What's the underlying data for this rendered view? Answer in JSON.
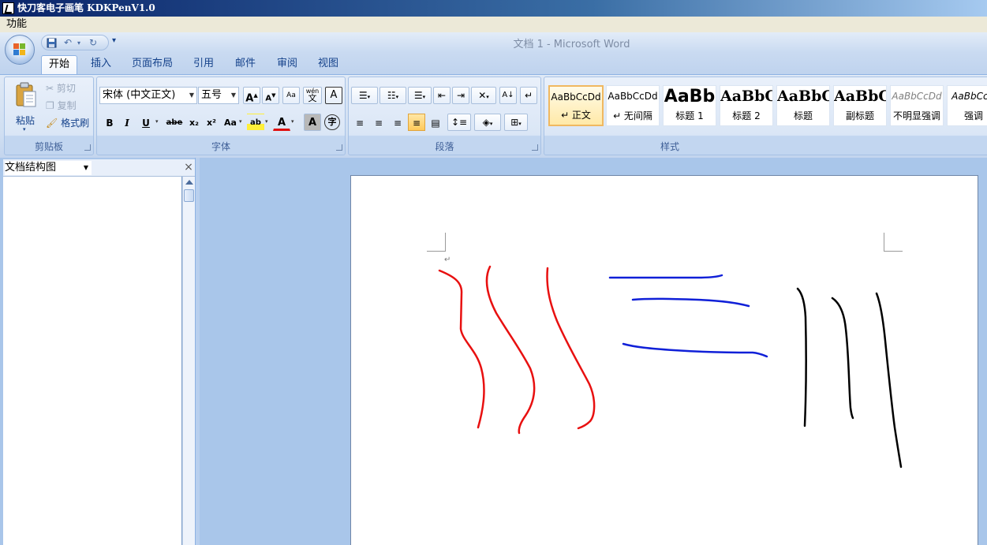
{
  "app_window": {
    "title": "快刀客电子画笔 KDKPenV1.0"
  },
  "menubar": {
    "items": [
      {
        "label": "功能"
      }
    ]
  },
  "word": {
    "title": "文档 1 - Microsoft Word",
    "qat": {
      "save_icon": "save-icon",
      "undo_icon": "undo-icon",
      "redo_icon": "redo-icon",
      "more_icon": "customize-qat-icon"
    },
    "tabs": [
      "开始",
      "插入",
      "页面布局",
      "引用",
      "邮件",
      "审阅",
      "视图"
    ],
    "active_tab": "开始",
    "clipboard": {
      "label": "剪贴板",
      "paste": "粘贴",
      "cut": "剪切",
      "copy": "复制",
      "format_painter": "格式刷"
    },
    "font": {
      "label": "字体",
      "font_name": "宋体 (中文正文)",
      "font_size": "五号",
      "grow": "A",
      "shrink": "A",
      "clear": "Aa",
      "phonetic": "wén",
      "phonetic_char": "文",
      "border_char": "A",
      "bold": "B",
      "italic": "I",
      "underline": "U",
      "strike": "abe",
      "subscript": "x₂",
      "superscript": "x²",
      "case": "Aa",
      "highlight": "ab",
      "font_color": "A",
      "char_shading": "A",
      "enclose": "字"
    },
    "paragraph": {
      "label": "段落"
    },
    "styles": {
      "label": "样式",
      "items": [
        {
          "preview": "AaBbCcDd",
          "name": "↵ 正文"
        },
        {
          "preview": "AaBbCcDd",
          "name": "↵ 无间隔"
        },
        {
          "preview": "AaBb",
          "name": "标题 1"
        },
        {
          "preview": "AaBbC",
          "name": "标题 2"
        },
        {
          "preview": "AaBbC",
          "name": "标题"
        },
        {
          "preview": "AaBbC",
          "name": "副标题"
        },
        {
          "preview": "AaBbCcDd",
          "name": "不明显强调"
        },
        {
          "preview": "AaBbCcD",
          "name": "强调"
        }
      ]
    },
    "doc_map": {
      "title": "文档结构图",
      "close": "×"
    },
    "document": {
      "paragraph_mark": "↵"
    }
  },
  "ink_colors": {
    "red": "#e81010",
    "blue": "#1020d8",
    "black": "#000000"
  }
}
